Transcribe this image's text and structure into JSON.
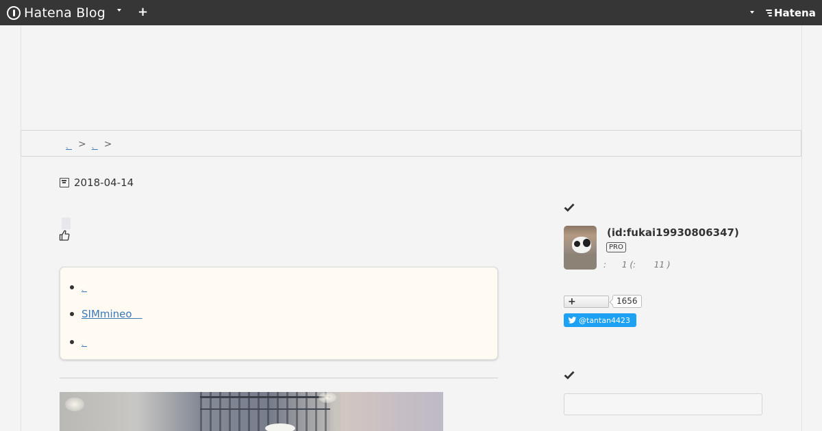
{
  "topbar": {
    "logo_text": "Hatena Blog",
    "add_icon": "plus-icon",
    "brand_text": "Hatena"
  },
  "breadcrumb": {
    "link1": "、",
    "link2": "、",
    "separator": ">"
  },
  "article": {
    "date": "2018-04-14",
    "toc": [
      {
        "text": "、",
        "tiny": true
      },
      {
        "text": "SIMmineo　",
        "tiny": false
      },
      {
        "text": "、",
        "tiny": true
      }
    ]
  },
  "sidebar": {
    "user_id": "(id:fukai19930806347)",
    "pro_badge": "PRO",
    "user_meta": ":      1 (:       11 )",
    "follow_count": "1656",
    "twitter_handle": "@tantan4423",
    "colors": {
      "twitter": "#1da1f2",
      "link": "#3a78b8",
      "topbar": "#363636"
    }
  }
}
